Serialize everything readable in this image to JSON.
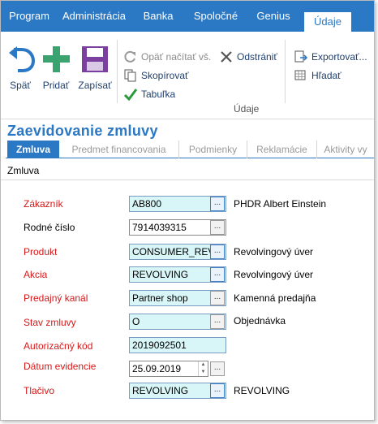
{
  "menu": {
    "tabs": [
      "Program",
      "Administrácia",
      "Banka",
      "Spoločné",
      "Genius",
      "Údaje"
    ]
  },
  "ribbon": {
    "back_label": "Späť",
    "add_label": "Pridať",
    "save_label": "Zapísať",
    "reload_label": "Opäť načítať vš.",
    "copy_label": "Skopírovať",
    "table_label": "Tabuľka",
    "delete_label": "Odstrániť",
    "group_label": "Údaje",
    "export_label": "Exportovať...",
    "search_label": "Hľadať"
  },
  "page": {
    "title": "Zaevidovanie zmluvy",
    "subtabs": [
      "Zmluva",
      "Predmet financovania",
      "Podmienky",
      "Reklamácie",
      "Aktivity vy"
    ],
    "section": "Zmluva"
  },
  "form": {
    "zakaznik": {
      "label": "Zákazník",
      "value": "AB800",
      "desc": "PHDR Albert Einstein"
    },
    "rodne_cislo": {
      "label": "Rodné číslo",
      "value": "7914039315"
    },
    "produkt": {
      "label": "Produkt",
      "value": "CONSUMER_REVC",
      "desc": "Revolvingový úver"
    },
    "akcia": {
      "label": "Akcia",
      "value": "REVOLVING",
      "desc": "Revolvingový úver"
    },
    "predajny_kanal": {
      "label": "Predajný kanál",
      "value": "Partner shop",
      "desc": "Kamenná predajňa"
    },
    "stav_zmluvy": {
      "label": "Stav zmluvy",
      "value": "O",
      "desc": "Objednávka"
    },
    "autorizacny_kod": {
      "label": "Autorizačný kód",
      "value": "2019092501"
    },
    "datum_evidencie": {
      "label": "Dátum evidencie",
      "value": "25.09.2019"
    },
    "tlacivo": {
      "label": "Tlačivo",
      "value": "REVOLVING",
      "desc": "REVOLVING"
    },
    "lookup_glyph": "..."
  },
  "colors": {
    "accent": "#2b78c5",
    "required": "#d61818",
    "field_bg": "#d8f6f8"
  }
}
